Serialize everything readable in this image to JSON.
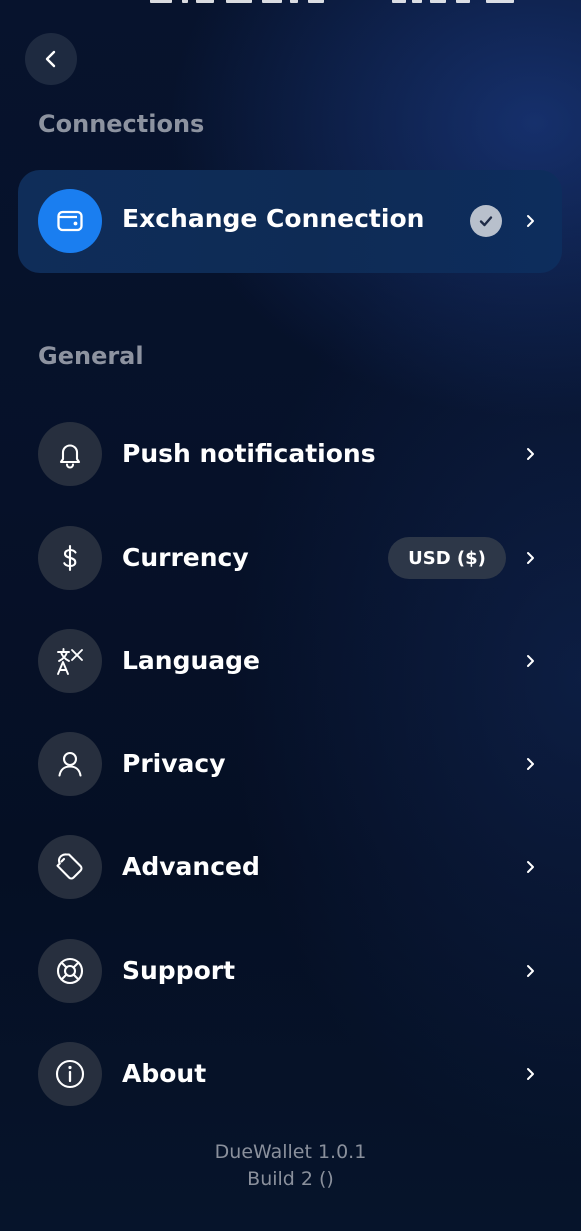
{
  "sections": {
    "connections_title": "Connections",
    "general_title": "General"
  },
  "exchange": {
    "label": "Exchange Connection",
    "icon": "wallet-icon",
    "status_icon": "check-circle-icon",
    "accent_color": "#1a7ef0"
  },
  "general_items": [
    {
      "label": "Push notifications",
      "icon": "bell-icon"
    },
    {
      "label": "Currency",
      "icon": "dollar-icon",
      "value": "USD ($)"
    },
    {
      "label": "Language",
      "icon": "translate-icon"
    },
    {
      "label": "Privacy",
      "icon": "user-icon"
    },
    {
      "label": "Advanced",
      "icon": "wrench-icon"
    },
    {
      "label": "Support",
      "icon": "lifebuoy-icon"
    },
    {
      "label": "About",
      "icon": "info-icon"
    }
  ],
  "footer": {
    "app_version": "DueWallet 1.0.1",
    "build": "Build 2 ()"
  }
}
